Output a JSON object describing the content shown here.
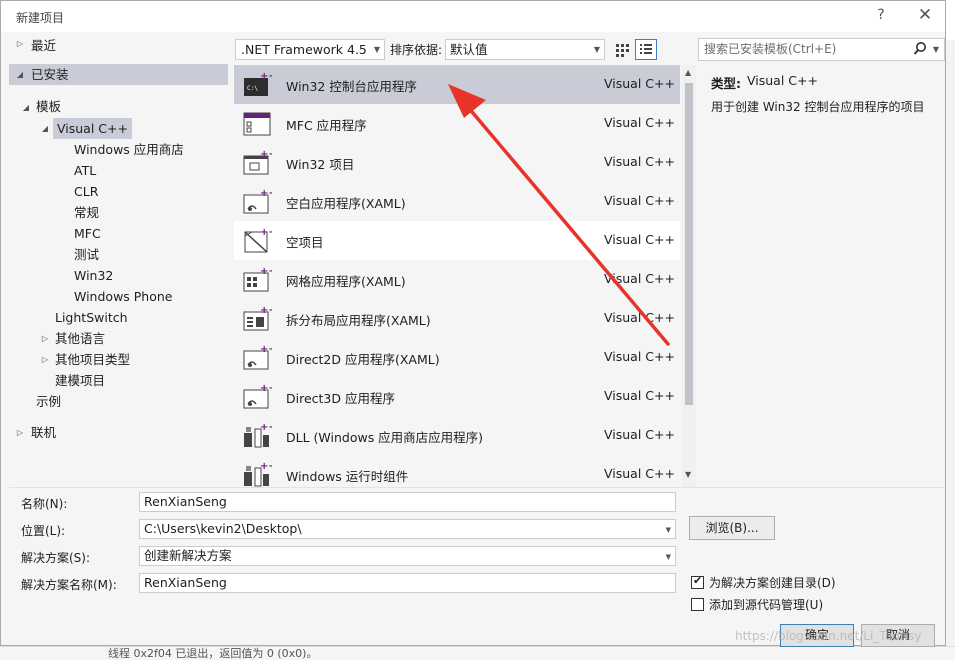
{
  "background": {
    "bottom_text": "线程 0x2f04 已退出，返回值为 0 (0x0)。"
  },
  "dialog": {
    "title": "新建项目",
    "help_glyph": "?",
    "close_glyph": "✕"
  },
  "tree": {
    "recent": "最近",
    "installed": "已安装",
    "templates": "模板",
    "visual_cpp": "Visual C++",
    "children": [
      "Windows 应用商店",
      "ATL",
      "CLR",
      "常规",
      "MFC",
      "测试",
      "Win32",
      "Windows Phone"
    ],
    "lightswitch": "LightSwitch",
    "other_languages": "其他语言",
    "other_project_types": "其他项目类型",
    "modeling_projects": "建模项目",
    "samples": "示例",
    "online": "联机"
  },
  "toolbar": {
    "framework": ".NET Framework 4.5",
    "sort_label": "排序依据:",
    "sort_value": "默认值",
    "search_placeholder": "搜索已安装模板(Ctrl+E)"
  },
  "templates": [
    {
      "name": "Win32 控制台应用程序",
      "lang": "Visual C++",
      "icon": "console-app-icon"
    },
    {
      "name": "MFC 应用程序",
      "lang": "Visual C++",
      "icon": "mfc-app-icon"
    },
    {
      "name": "Win32 项目",
      "lang": "Visual C++",
      "icon": "win32-project-icon"
    },
    {
      "name": "空白应用程序(XAML)",
      "lang": "Visual C++",
      "icon": "blank-xaml-app-icon"
    },
    {
      "name": "空项目",
      "lang": "Visual C++",
      "icon": "empty-project-icon"
    },
    {
      "name": "网格应用程序(XAML)",
      "lang": "Visual C++",
      "icon": "grid-xaml-app-icon"
    },
    {
      "name": "拆分布局应用程序(XAML)",
      "lang": "Visual C++",
      "icon": "split-xaml-app-icon"
    },
    {
      "name": "Direct2D 应用程序(XAML)",
      "lang": "Visual C++",
      "icon": "direct2d-app-icon"
    },
    {
      "name": "Direct3D 应用程序",
      "lang": "Visual C++",
      "icon": "direct3d-app-icon"
    },
    {
      "name": "DLL (Windows 应用商店应用程序)",
      "lang": "Visual C++",
      "icon": "dll-store-icon"
    },
    {
      "name": "Windows 运行时组件",
      "lang": "Visual C++",
      "icon": "winrt-component-icon"
    }
  ],
  "info": {
    "type_label": "类型:",
    "type_value": "Visual C++",
    "description": "用于创建 Win32 控制台应用程序的项目"
  },
  "form": {
    "name_label": "名称(N):",
    "name_value": "RenXianSeng",
    "location_label": "位置(L):",
    "location_value": "C:\\Users\\kevin2\\Desktop\\",
    "solution_label": "解决方案(S):",
    "solution_value": "创建新解决方案",
    "solution_name_label": "解决方案名称(M):",
    "solution_name_value": "RenXianSeng",
    "browse_label": "浏览(B)...",
    "create_dir_label": "为解决方案创建目录(D)",
    "create_dir_checked": true,
    "source_control_label": "添加到源代码管理(U)",
    "source_control_checked": false,
    "ok_label": "确定",
    "cancel_label": "取消"
  },
  "watermark": "https://blog.csdn.net/Li_Tuorisy",
  "colors": {
    "selection": "#c9ccd6",
    "accent": "#3e7bd3",
    "arrow": "#e8332a",
    "icon_purple": "#68217a"
  }
}
